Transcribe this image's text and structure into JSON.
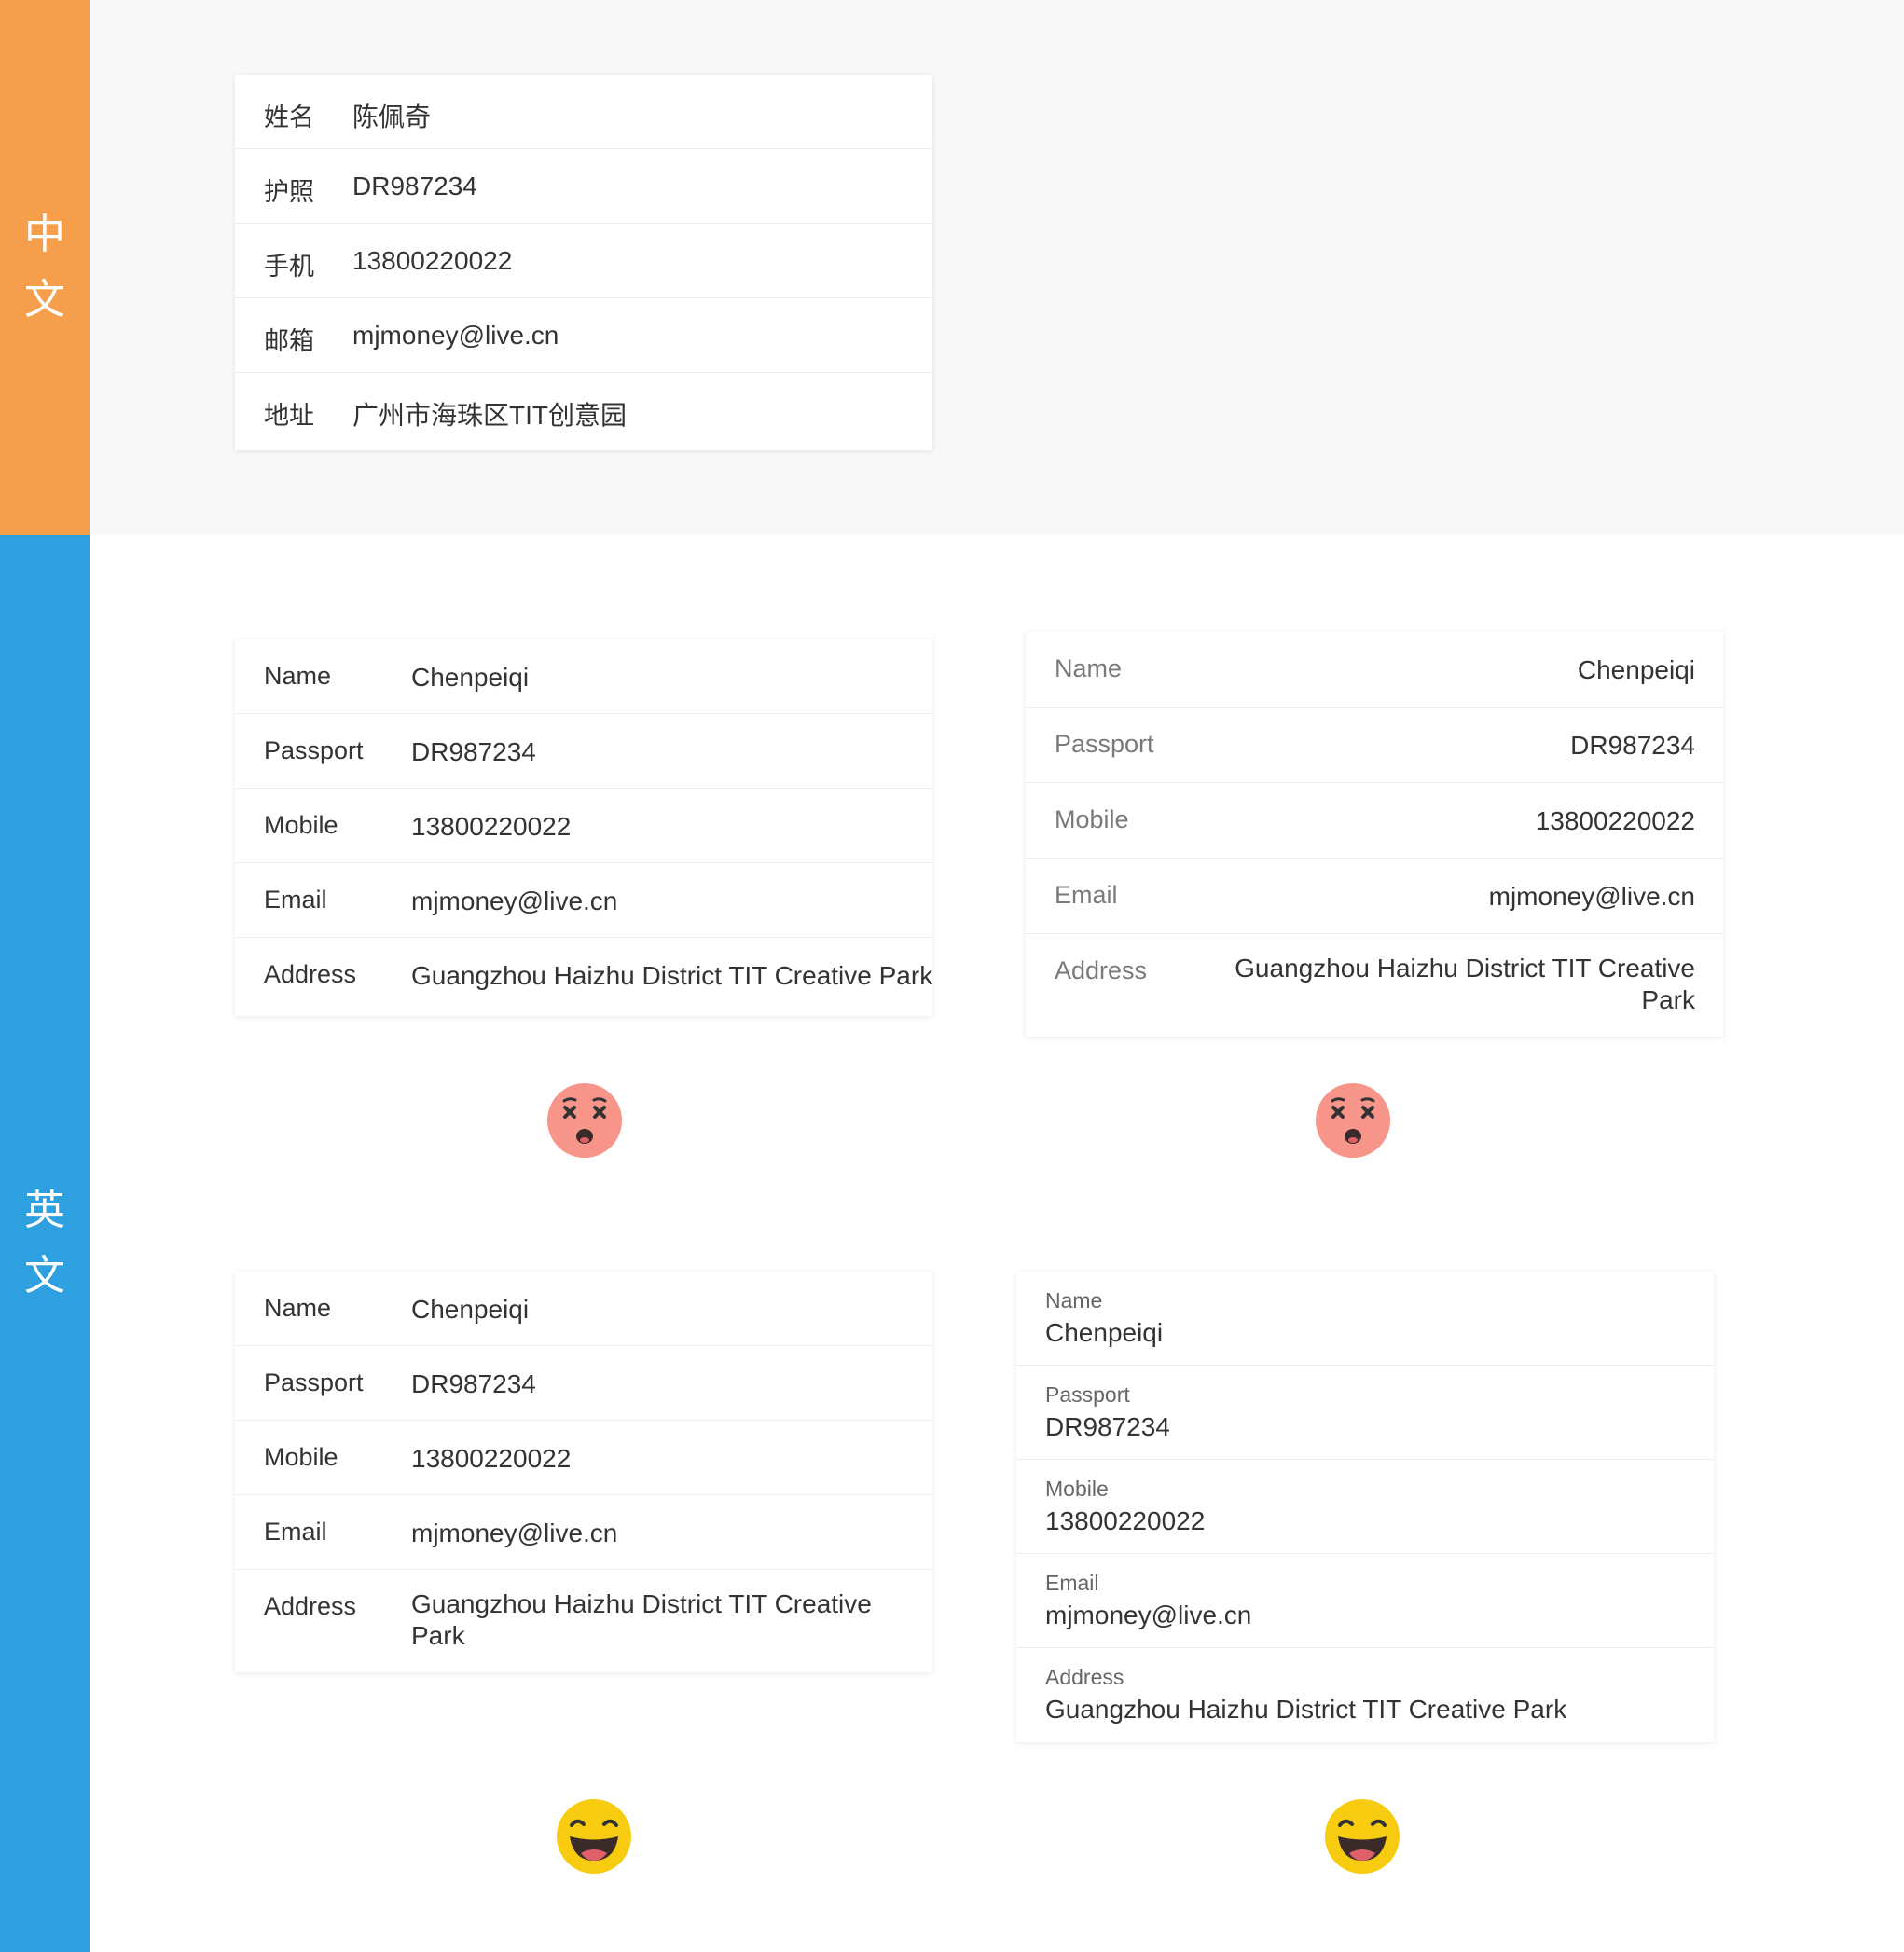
{
  "sections": {
    "chinese_label": "中文",
    "english_label": "英文"
  },
  "colors": {
    "chinese_accent": "#f59f4c",
    "english_accent": "#2e9fdf",
    "bad_emoji": "#f7958a",
    "good_emoji": "#f7cb10"
  },
  "cn_card": {
    "rows": [
      {
        "label": "姓名",
        "value": "陈佩奇"
      },
      {
        "label": "护照",
        "value": "DR987234"
      },
      {
        "label": "手机",
        "value": "13800220022"
      },
      {
        "label": "邮箱",
        "value": "mjmoney@live.cn"
      },
      {
        "label": "地址",
        "value": "广州市海珠区TIT创意园"
      }
    ]
  },
  "en_rows": [
    {
      "label": "Name",
      "value": "Chenpeiqi"
    },
    {
      "label": "Passport",
      "value": "DR987234"
    },
    {
      "label": "Mobile",
      "value": "13800220022"
    },
    {
      "label": "Email",
      "value": "mjmoney@live.cn"
    },
    {
      "label": "Address",
      "value": "Guangzhou Haizhu District TIT Creative Park"
    }
  ],
  "examples": [
    {
      "variant": "overflow",
      "verdict": "bad",
      "emoji": "dizzy-face-icon"
    },
    {
      "variant": "right-aligned",
      "verdict": "bad",
      "emoji": "dizzy-face-icon"
    },
    {
      "variant": "wrapped",
      "verdict": "good",
      "emoji": "grinning-face-icon"
    },
    {
      "variant": "stacked",
      "verdict": "good",
      "emoji": "grinning-face-icon"
    }
  ]
}
